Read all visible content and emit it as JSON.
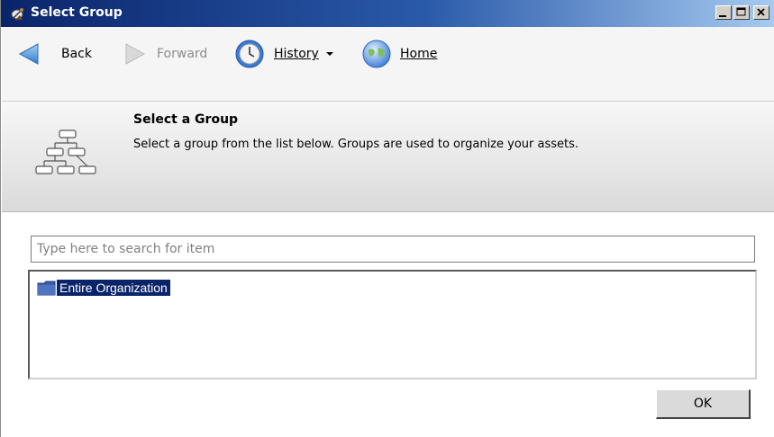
{
  "window": {
    "title": "Select Group",
    "icon": "satellite-dish-icon",
    "controls": [
      "minimize",
      "maximize",
      "close"
    ]
  },
  "toolbar": {
    "back_label": "Back",
    "forward_label": "Forward",
    "history_label": "History",
    "home_label": "Home"
  },
  "header": {
    "icon": "group-hierarchy-icon",
    "title": "Select a Group",
    "description": "Select a group from the list below. Groups are used to organize your assets."
  },
  "search": {
    "placeholder": "Type here to search for item",
    "value": ""
  },
  "tree": {
    "items": [
      {
        "label": "Entire Organization",
        "icon": "folder-icon",
        "selected": true
      }
    ]
  },
  "actions": {
    "ok_label": "OK"
  },
  "colors": {
    "selection": "#0a246a",
    "titlebar_start": "#0a246a",
    "titlebar_end": "#a6caf0"
  }
}
